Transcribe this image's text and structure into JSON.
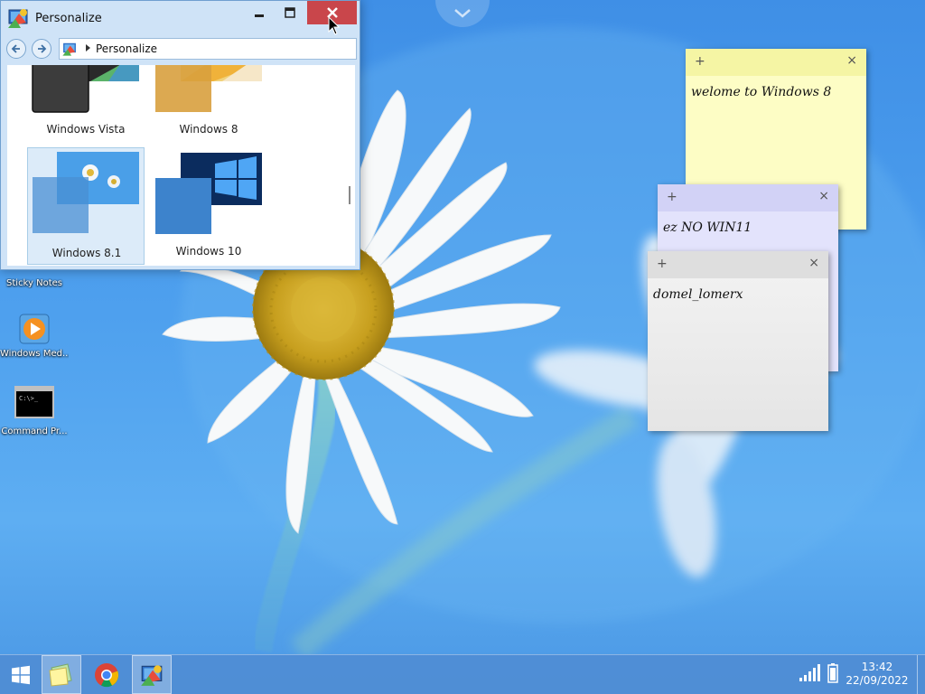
{
  "window": {
    "title": "Personalize",
    "address": "Personalize",
    "themes": [
      {
        "label": "Windows Vista"
      },
      {
        "label": "Windows 8"
      },
      {
        "label": "Windows 8.1",
        "selected": true
      },
      {
        "label": "Windows 10"
      }
    ]
  },
  "desktop_icons": [
    {
      "label": "Sticky Notes"
    },
    {
      "label": "Windows Med..."
    },
    {
      "label": "Command Pr..."
    }
  ],
  "sticky_notes": [
    {
      "text": "welome to Windows 8",
      "color": "#fdfdc5"
    },
    {
      "text": "ez NO WIN11",
      "color": "#e3e3fc"
    },
    {
      "text": "domel_lomerx",
      "color": "#eeeeee"
    }
  ],
  "command_icon_text": "C:\\>_",
  "taskbar": {
    "time": "13:42",
    "date": "22/09/2022"
  },
  "colors": {
    "accent": "#c9464b",
    "desktop": "#4ea0ee"
  }
}
